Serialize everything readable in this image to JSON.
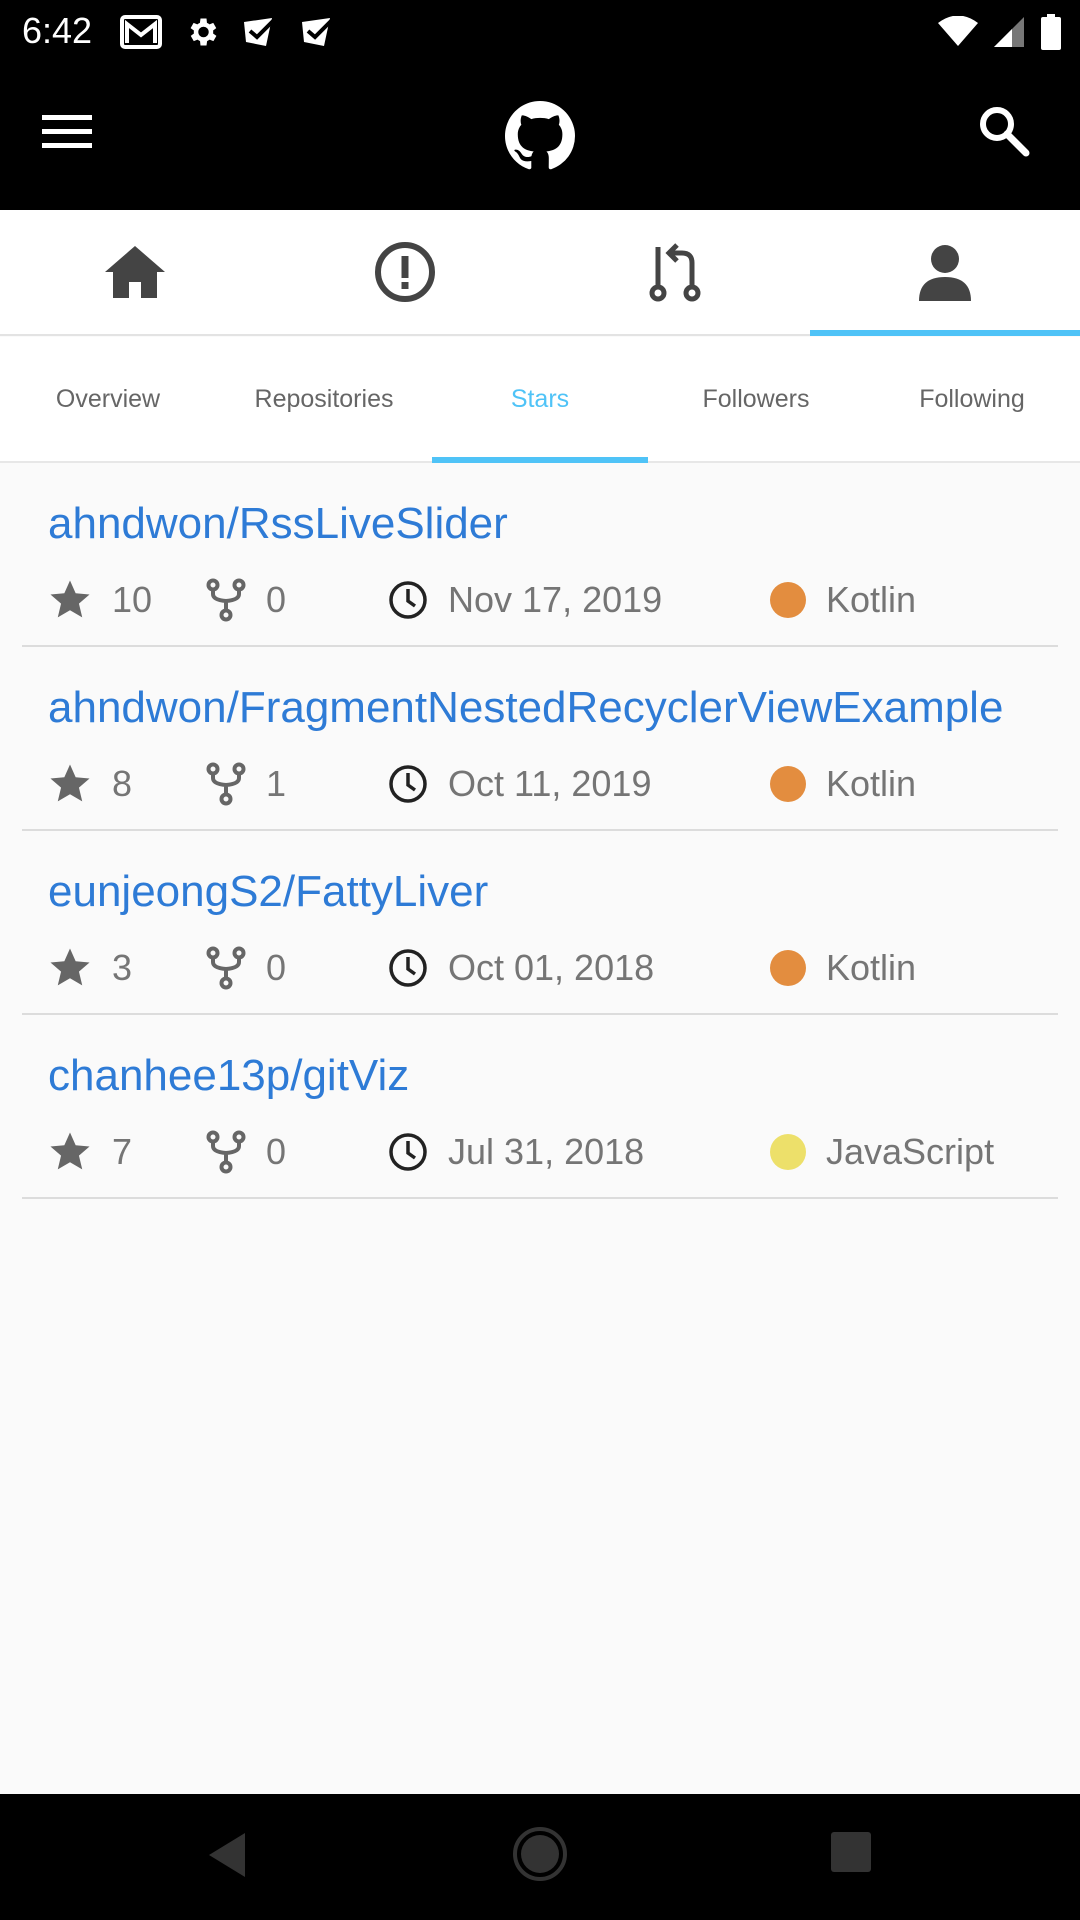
{
  "status_bar": {
    "time": "6:42",
    "left_icons": [
      "gmail-icon",
      "settings-icon",
      "checkbox-icon",
      "checkbox-icon"
    ],
    "right_icons": [
      "wifi-icon",
      "signal-icon",
      "battery-icon"
    ]
  },
  "app_bar": {
    "menu_icon": "menu-icon",
    "logo_icon": "github-logo-icon",
    "search_icon": "search-icon"
  },
  "main_nav": {
    "items": [
      {
        "icon": "home-icon",
        "active": false
      },
      {
        "icon": "issues-icon",
        "active": false
      },
      {
        "icon": "pull-request-icon",
        "active": false
      },
      {
        "icon": "profile-icon",
        "active": true
      }
    ]
  },
  "sub_tabs": {
    "items": [
      {
        "label": "Overview",
        "active": false
      },
      {
        "label": "Repositories",
        "active": false
      },
      {
        "label": "Stars",
        "active": true
      },
      {
        "label": "Followers",
        "active": false
      },
      {
        "label": "Following",
        "active": false
      }
    ]
  },
  "repos": [
    {
      "name": "ahndwon/RssLiveSlider",
      "stars": "10",
      "forks": "0",
      "date": "Nov 17, 2019",
      "language": "Kotlin",
      "lang_color": "#e38d3f"
    },
    {
      "name": "ahndwon/FragmentNestedRecyclerViewExample",
      "stars": "8",
      "forks": "1",
      "date": "Oct 11, 2019",
      "language": "Kotlin",
      "lang_color": "#e38d3f"
    },
    {
      "name": "eunjeongS2/FattyLiver",
      "stars": "3",
      "forks": "0",
      "date": "Oct 01, 2018",
      "language": "Kotlin",
      "lang_color": "#e38d3f"
    },
    {
      "name": "chanhee13p/gitViz",
      "stars": "7",
      "forks": "0",
      "date": "Jul 31, 2018",
      "language": "JavaScript",
      "lang_color": "#ede06a"
    }
  ],
  "colors": {
    "accent": "#4fc3f7",
    "link": "#2e7bd6",
    "meta_text": "#757575",
    "bar_background": "#000000"
  }
}
